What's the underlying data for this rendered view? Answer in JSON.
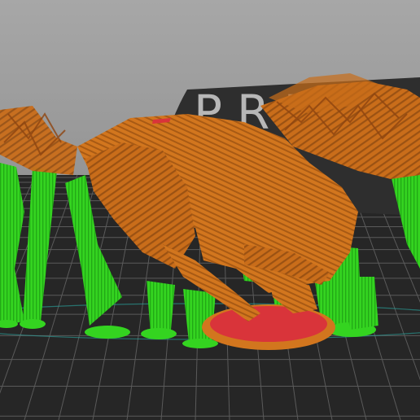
{
  "viewer": {
    "bed_logo_text": "PRUSA",
    "colors": {
      "background": "#9a9a9a",
      "bed": "#262626",
      "grid_line": "#5c5c5c",
      "model": "#d2761e",
      "model_dark": "#8f4510",
      "support": "#34d420",
      "support_dark": "#1f8f12",
      "base_red": "#d9343a",
      "bed_boundary": "#2aa7a0"
    }
  }
}
